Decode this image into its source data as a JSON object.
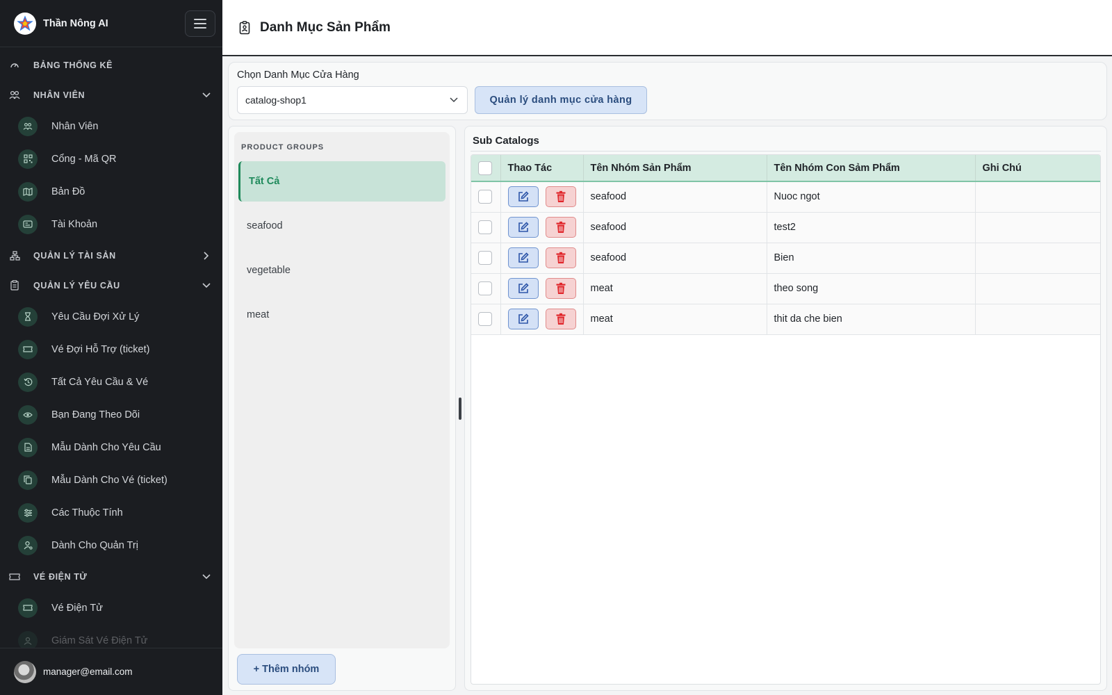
{
  "sidebar": {
    "brand": "Thần Nông AI",
    "sections": {
      "dashboard": "BẢNG THỐNG KÊ",
      "staff": "NHÂN VIÊN",
      "assets": "QUẢN LÝ TÀI SẢN",
      "requests": "QUẢN LÝ YÊU CẦU",
      "eticket": "VÉ ĐIỆN TỬ"
    },
    "staff_items": [
      "Nhân Viên",
      "Cổng - Mã QR",
      "Bản Đồ",
      "Tài Khoản"
    ],
    "request_items": [
      "Yêu Cầu Đợi Xử Lý",
      "Vé Đợi Hỗ Trợ (ticket)",
      "Tất Cả Yêu Cầu & Vé",
      "Bạn Đang Theo Dõi",
      "Mẫu Dành Cho Yêu Cầu",
      "Mẫu Dành Cho Vé (ticket)",
      "Các Thuộc Tính",
      "Dành Cho Quản Trị"
    ],
    "eticket_items": [
      "Vé Điện Tử",
      "Giám Sát Vé Điện Tử"
    ],
    "user_email": "manager@email.com"
  },
  "header": {
    "title": "Danh Mục Sản Phẩm"
  },
  "catalog": {
    "label": "Chọn Danh Mục Cửa Hàng",
    "selected": "catalog-shop1",
    "manage_button": "Quản lý danh mục cửa hàng"
  },
  "groups": {
    "title": "PRODUCT GROUPS",
    "items": [
      "Tất Cả",
      "seafood",
      "vegetable",
      "meat"
    ],
    "add_button": "+ Thêm nhóm"
  },
  "subcatalogs": {
    "title": "Sub Catalogs",
    "columns": [
      "Thao Tác",
      "Tên Nhóm Sản Phẩm",
      "Tên Nhóm Con Sảm Phẩm",
      "Ghi Chú"
    ],
    "rows": [
      {
        "group": "seafood",
        "sub": "Nuoc ngot",
        "note": ""
      },
      {
        "group": "seafood",
        "sub": "test2",
        "note": ""
      },
      {
        "group": "seafood",
        "sub": "Bien",
        "note": ""
      },
      {
        "group": "meat",
        "sub": "theo song",
        "note": ""
      },
      {
        "group": "meat",
        "sub": "thit da che bien",
        "note": ""
      }
    ]
  },
  "colors": {
    "sidebar_bg": "#1b1d21",
    "accent_green": "#1f8a5b",
    "header_green": "#d4ebe1",
    "button_blue": "#d7e4f7",
    "delete_red": "#e0262b"
  }
}
